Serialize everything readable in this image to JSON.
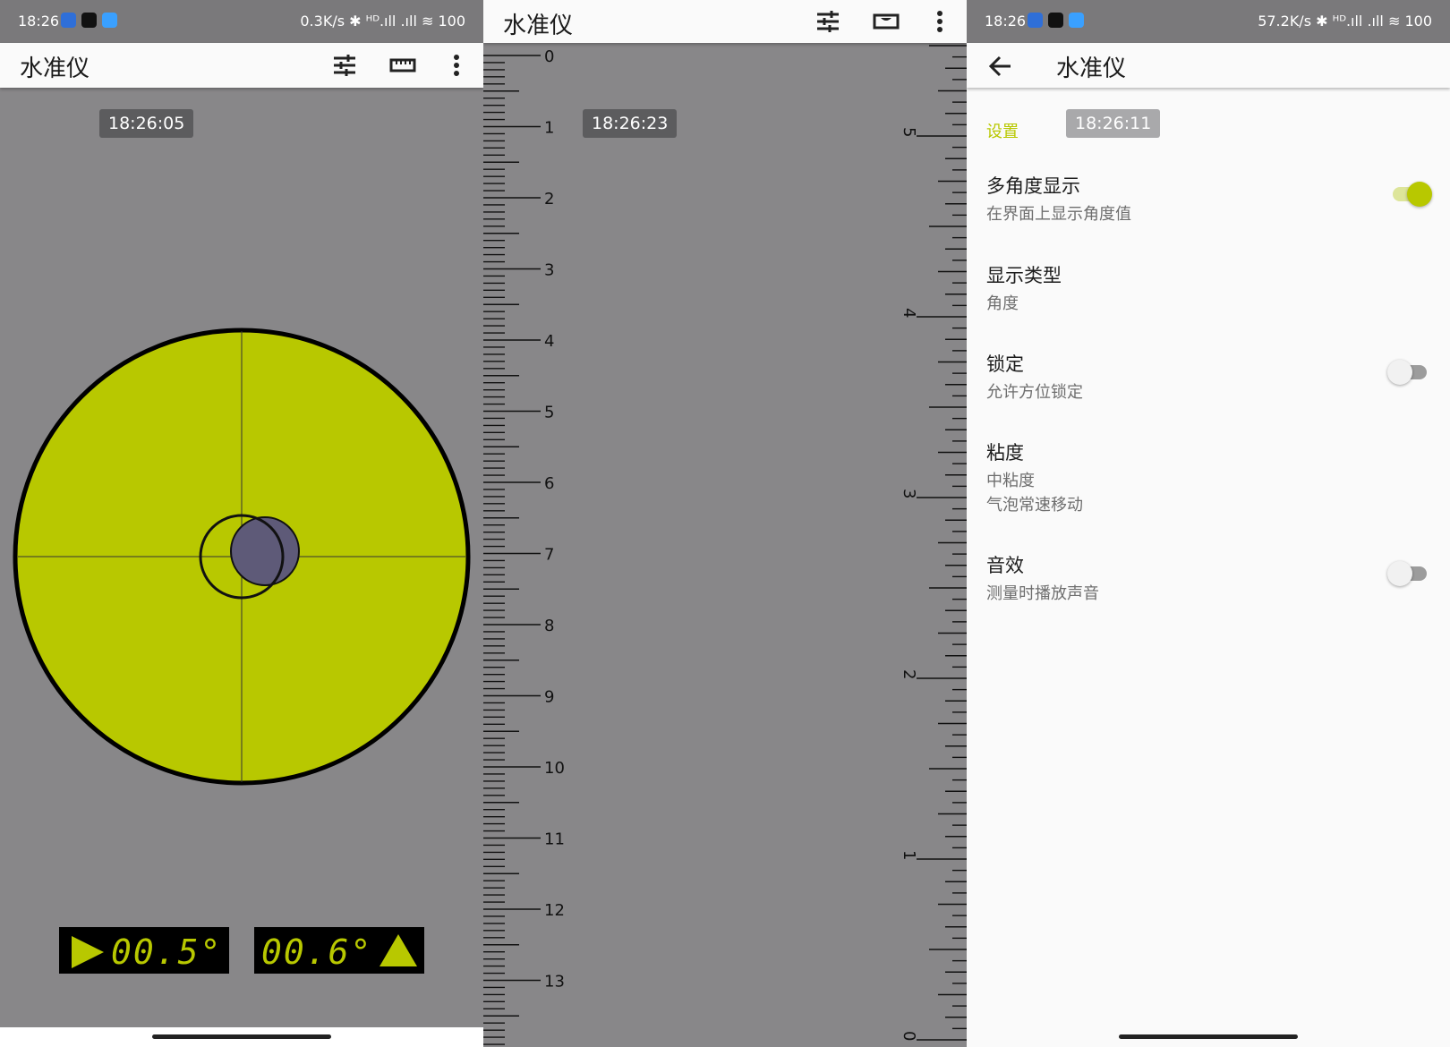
{
  "panel_level": {
    "status": {
      "time": "18:26",
      "right": "0.3K/s ✱ ᴴᴰ.ıll .ıll ≋ 100"
    },
    "app_title": "水准仪",
    "timestamp": "18:26:05",
    "readout_x": "00.5°",
    "readout_y": "00.6°",
    "bubble_x_deg": 0.5,
    "bubble_y_deg": 0.6,
    "colors": {
      "vial": "#b8c800",
      "bubble": "#5e5a78",
      "background": "#888789"
    }
  },
  "panel_ruler": {
    "app_title": "水准仪",
    "timestamp": "18:26:23",
    "left_scale_labels": [
      "0",
      "1",
      "2",
      "3",
      "4",
      "5",
      "6",
      "7",
      "8",
      "9",
      "10",
      "11",
      "12",
      "13"
    ],
    "right_scale_labels": [
      "5",
      "4",
      "3",
      "2",
      "1",
      "0"
    ]
  },
  "panel_settings": {
    "status": {
      "time": "18:26",
      "right": "57.2K/s ✱ ᴴᴰ.ıll .ıll ≋ 100"
    },
    "app_title": "水准仪",
    "section_label": "设置",
    "timestamp": "18:26:11",
    "items": [
      {
        "title": "多角度显示",
        "subtitle": "在界面上显示角度值",
        "switch_on": true
      },
      {
        "title": "显示类型",
        "subtitle": "角度"
      },
      {
        "title": "锁定",
        "subtitle": "允许方位锁定",
        "switch_on": false
      },
      {
        "title": "粘度",
        "subtitle": "中粘度",
        "subtitle2": "气泡常速移动"
      },
      {
        "title": "音效",
        "subtitle": "测量时播放声音",
        "switch_on": false
      }
    ],
    "accent": "#b8c800"
  }
}
